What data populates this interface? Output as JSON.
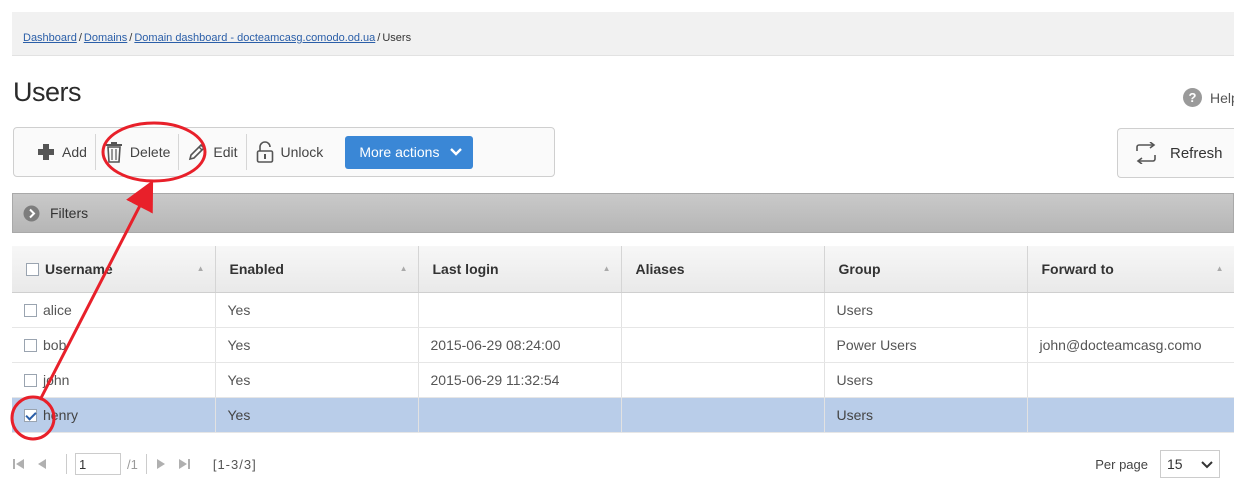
{
  "breadcrumb": {
    "items": [
      "Dashboard",
      "Domains",
      "Domain dashboard - docteamcasg.comodo.od.ua"
    ],
    "current": "Users",
    "separator": "/"
  },
  "page": {
    "title": "Users"
  },
  "help": {
    "label": "Help",
    "icon": "help-icon"
  },
  "toolbar": {
    "add_label": "Add",
    "delete_label": "Delete",
    "edit_label": "Edit",
    "unlock_label": "Unlock",
    "more_label": "More actions"
  },
  "refresh": {
    "label": "Refresh"
  },
  "filters": {
    "label": "Filters"
  },
  "table": {
    "columns": [
      "Username",
      "Enabled",
      "Last login",
      "Aliases",
      "Group",
      "Forward to"
    ],
    "rows": [
      {
        "username": "alice",
        "enabled": "Yes",
        "last_login": "",
        "aliases": "",
        "group": "Users",
        "forward_to": "",
        "checked": false
      },
      {
        "username": "bob",
        "enabled": "Yes",
        "last_login": "2015-06-29 08:24:00",
        "aliases": "",
        "group": "Power Users",
        "forward_to": "john@docteamcasg.como",
        "checked": false
      },
      {
        "username": "john",
        "enabled": "Yes",
        "last_login": "2015-06-29 11:32:54",
        "aliases": "",
        "group": "Users",
        "forward_to": "",
        "checked": false
      },
      {
        "username": "henry",
        "enabled": "Yes",
        "last_login": "",
        "aliases": "",
        "group": "Users",
        "forward_to": "",
        "checked": true
      }
    ]
  },
  "pager": {
    "page": "1",
    "of_pages": "/1",
    "range": "[1-3/3]",
    "per_page_label": "Per page",
    "per_page_value": "15"
  },
  "colors": {
    "accent": "#3a87d6",
    "link": "#2a5ea8",
    "selected_row": "#b9cde9",
    "annotation": "#e8202a"
  }
}
